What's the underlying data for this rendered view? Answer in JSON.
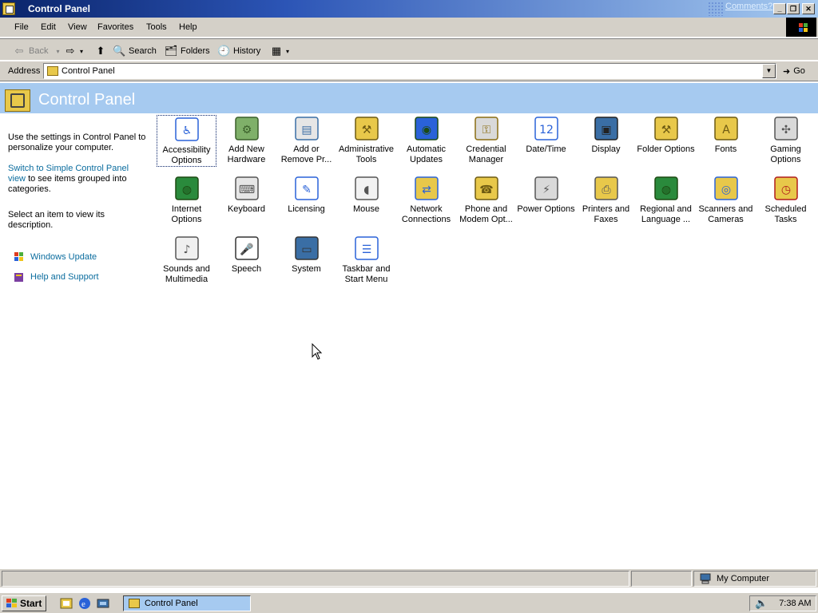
{
  "window": {
    "title": "Control Panel",
    "comments": "Comments?"
  },
  "menu": [
    "File",
    "Edit",
    "View",
    "Favorites",
    "Tools",
    "Help"
  ],
  "toolbar": {
    "back": "Back",
    "search": "Search",
    "folders": "Folders",
    "history": "History"
  },
  "address": {
    "label": "Address",
    "value": "Control Panel",
    "go": "Go"
  },
  "header": {
    "title": "Control Panel"
  },
  "left_pane": {
    "intro": "Use the settings in Control Panel to personalize your computer.",
    "switch_link": "Switch to Simple Control Panel view",
    "switch_rest": "to see items grouped into categories.",
    "select_hint": "Select an item to view its description.",
    "windows_update": "Windows Update",
    "help_support": "Help and Support"
  },
  "items": [
    {
      "label": "Accessibility Options",
      "icon": "accessibility-icon"
    },
    {
      "label": "Add New Hardware",
      "icon": "add-hardware-icon"
    },
    {
      "label": "Add or Remove Pr...",
      "icon": "add-remove-programs-icon"
    },
    {
      "label": "Administrative Tools",
      "icon": "administrative-tools-icon"
    },
    {
      "label": "Automatic Updates",
      "icon": "automatic-updates-icon"
    },
    {
      "label": "Credential Manager",
      "icon": "credential-manager-icon"
    },
    {
      "label": "Date/Time",
      "icon": "date-time-icon"
    },
    {
      "label": "Display",
      "icon": "display-icon"
    },
    {
      "label": "Folder Options",
      "icon": "folder-options-icon"
    },
    {
      "label": "Fonts",
      "icon": "fonts-icon"
    },
    {
      "label": "Gaming Options",
      "icon": "gaming-options-icon"
    },
    {
      "label": "Internet Options",
      "icon": "internet-options-icon"
    },
    {
      "label": "Keyboard",
      "icon": "keyboard-icon"
    },
    {
      "label": "Licensing",
      "icon": "licensing-icon"
    },
    {
      "label": "Mouse",
      "icon": "mouse-icon"
    },
    {
      "label": "Network Connections",
      "icon": "network-connections-icon"
    },
    {
      "label": "Phone and Modem Opt...",
      "icon": "phone-modem-icon"
    },
    {
      "label": "Power Options",
      "icon": "power-options-icon"
    },
    {
      "label": "Printers and Faxes",
      "icon": "printers-faxes-icon"
    },
    {
      "label": "Regional and Language ...",
      "icon": "regional-language-icon"
    },
    {
      "label": "Scanners and Cameras",
      "icon": "scanners-cameras-icon"
    },
    {
      "label": "Scheduled Tasks",
      "icon": "scheduled-tasks-icon"
    },
    {
      "label": "Sounds and Multimedia",
      "icon": "sounds-multimedia-icon"
    },
    {
      "label": "Speech",
      "icon": "speech-icon"
    },
    {
      "label": "System",
      "icon": "system-icon"
    },
    {
      "label": "Taskbar and Start Menu",
      "icon": "taskbar-start-menu-icon"
    }
  ],
  "statusbar": {
    "zone": "My Computer"
  },
  "taskbar": {
    "start": "Start",
    "task": "Control Panel",
    "clock": "7:38 AM"
  },
  "colors": {
    "header_bg": "#a6caf0",
    "link": "#0a6c9e",
    "chrome": "#d4d0c8"
  }
}
